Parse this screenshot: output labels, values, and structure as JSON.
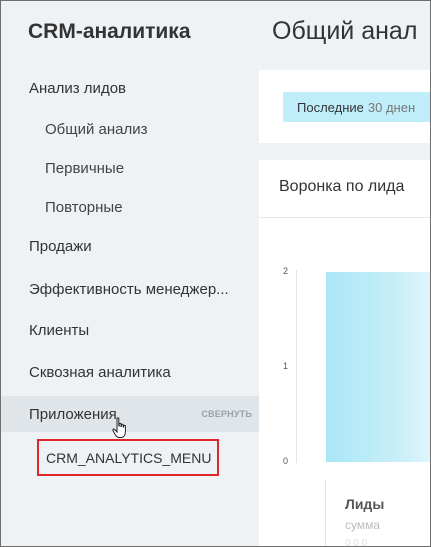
{
  "app_title": "CRM-аналитика",
  "sidebar": {
    "items": [
      {
        "label": "Анализ лидов"
      },
      {
        "label": "Общий анализ"
      },
      {
        "label": "Первичные"
      },
      {
        "label": "Повторные"
      },
      {
        "label": "Продажи"
      },
      {
        "label": "Эффективность менеджер..."
      },
      {
        "label": "Клиенты"
      },
      {
        "label": "Сквозная аналитика"
      },
      {
        "label": "Приложения",
        "action": "СВЕРНУТЬ"
      }
    ],
    "submenu_item": "CRM_ANALYTICS_MENU"
  },
  "main": {
    "title": "Общий анал",
    "filter": {
      "label": "Последние",
      "value": "30 днен"
    },
    "chart": {
      "title": "Воронка по лида",
      "legend_title": "Лиды",
      "legend_sub": "сумма",
      "legend_sub2": "0  0  0"
    }
  },
  "chart_data": {
    "type": "bar",
    "title": "Воронка по лида",
    "categories": [
      "Лиды"
    ],
    "values": [
      2
    ],
    "ylim": [
      0,
      2
    ],
    "yticks": [
      "2",
      "1",
      "0"
    ]
  }
}
